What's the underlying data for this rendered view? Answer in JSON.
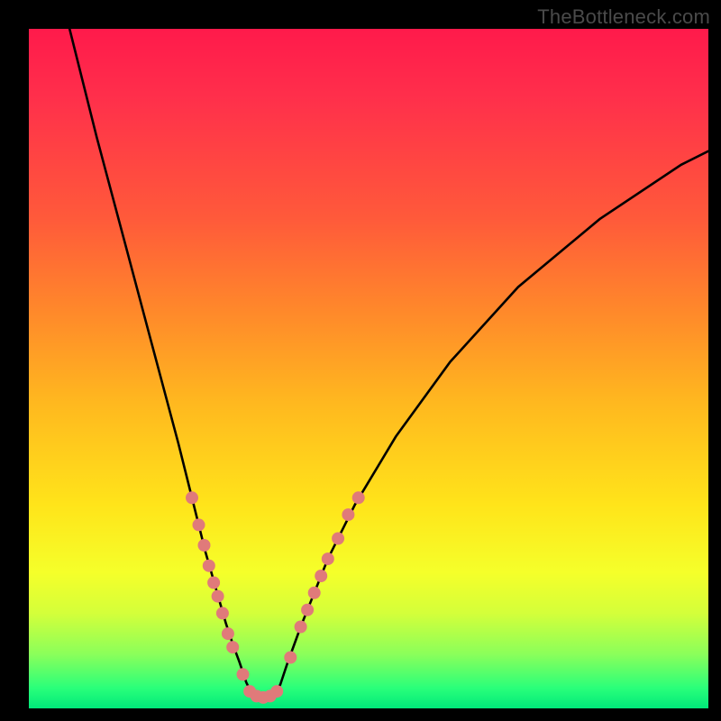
{
  "watermark": "TheBottleneck.com",
  "chart_data": {
    "type": "line",
    "title": "",
    "xlabel": "",
    "ylabel": "",
    "xlim": [
      0,
      100
    ],
    "ylim": [
      0,
      100
    ],
    "grid": false,
    "legend": false,
    "description": "Bottleneck curve: two branches descending from high bottleneck on the left and right toward a minimum near x≈32–36, overlaid on a vertical rainbow gradient (red=top/high, green=bottom/low). Pink dots mark sampled points along both branches near the minimum.",
    "series": [
      {
        "name": "left-branch",
        "x": [
          6,
          10,
          14,
          18,
          22,
          24,
          26,
          27,
          28,
          29,
          30,
          31,
          32,
          33
        ],
        "y": [
          100,
          84,
          69,
          54,
          39,
          31,
          23,
          19.5,
          16,
          12.5,
          9.5,
          6.8,
          3.8,
          1.8
        ]
      },
      {
        "name": "right-branch",
        "x": [
          36,
          37,
          38,
          40,
          42,
          44,
          48,
          54,
          62,
          72,
          84,
          96,
          100
        ],
        "y": [
          1.8,
          3.5,
          6.5,
          12,
          17,
          22,
          30,
          40,
          51,
          62,
          72,
          80,
          82
        ]
      },
      {
        "name": "floor",
        "x": [
          33,
          34,
          35,
          36
        ],
        "y": [
          1.8,
          1.6,
          1.6,
          1.8
        ]
      }
    ],
    "markers": {
      "name": "sample-dots",
      "color": "#e07a7a",
      "radius_px": 7,
      "points": [
        {
          "x": 24.0,
          "y": 31.0
        },
        {
          "x": 25.0,
          "y": 27.0
        },
        {
          "x": 25.8,
          "y": 24.0
        },
        {
          "x": 26.5,
          "y": 21.0
        },
        {
          "x": 27.2,
          "y": 18.5
        },
        {
          "x": 27.8,
          "y": 16.5
        },
        {
          "x": 28.5,
          "y": 14.0
        },
        {
          "x": 29.3,
          "y": 11.0
        },
        {
          "x": 30.0,
          "y": 9.0
        },
        {
          "x": 31.5,
          "y": 5.0
        },
        {
          "x": 32.5,
          "y": 2.5
        },
        {
          "x": 33.5,
          "y": 1.8
        },
        {
          "x": 34.5,
          "y": 1.6
        },
        {
          "x": 35.5,
          "y": 1.8
        },
        {
          "x": 36.5,
          "y": 2.5
        },
        {
          "x": 38.5,
          "y": 7.5
        },
        {
          "x": 40.0,
          "y": 12.0
        },
        {
          "x": 41.0,
          "y": 14.5
        },
        {
          "x": 42.0,
          "y": 17.0
        },
        {
          "x": 43.0,
          "y": 19.5
        },
        {
          "x": 44.0,
          "y": 22.0
        },
        {
          "x": 45.5,
          "y": 25.0
        },
        {
          "x": 47.0,
          "y": 28.5
        },
        {
          "x": 48.5,
          "y": 31.0
        }
      ]
    }
  }
}
